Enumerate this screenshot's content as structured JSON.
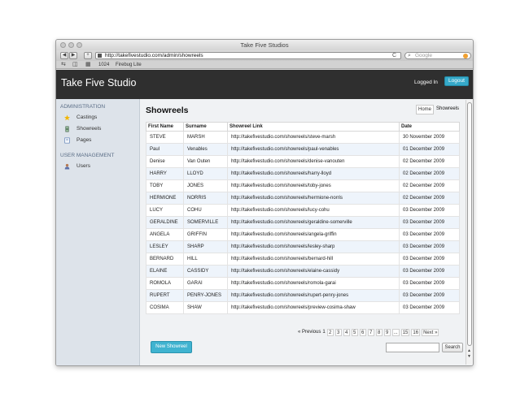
{
  "window": {
    "title": "Take Five Studios"
  },
  "browser": {
    "url": "http://takefivestudio.com/admin/showreels",
    "search_placeholder": "Google",
    "back_label": "◀",
    "forward_label": "▶",
    "add_label": "+",
    "reload_label": "C",
    "bookmarks": {
      "resolution": "1024",
      "firebug": "Firebug Lite"
    }
  },
  "app": {
    "brand": "Take Five Studio",
    "logged_in_label": "Logged In",
    "logout_label": "Logout"
  },
  "sidebar": {
    "sections": [
      {
        "heading": "ADMINISTRATION",
        "items": [
          {
            "label": "Castings",
            "icon": "star-icon"
          },
          {
            "label": "Showreels",
            "icon": "film-icon"
          },
          {
            "label": "Pages",
            "icon": "page-icon"
          }
        ]
      },
      {
        "heading": "USER MANAGEMENT",
        "items": [
          {
            "label": "Users",
            "icon": "user-icon"
          }
        ]
      }
    ]
  },
  "main": {
    "title": "Showreels",
    "breadcrumb": {
      "home": "Home",
      "current": "Showreels"
    },
    "table": {
      "headers": [
        "First Name",
        "Surname",
        "Showreel Link",
        "Date"
      ],
      "rows": [
        [
          "STEVE",
          "MARSH",
          "http://takefivestudio.com/showreels/steve-marsh",
          "30 November 2009"
        ],
        [
          "Paul",
          "Venables",
          "http://takefivestudio.com/showreels/paul-venables",
          "01 December 2009"
        ],
        [
          "Denise",
          "Van Outen",
          "http://takefivestudio.com/showreels/denise-vanouten",
          "02 December 2009"
        ],
        [
          "HARRY",
          "LLOYD",
          "http://takefivestudio.com/showreels/harry-lloyd",
          "02 December 2009"
        ],
        [
          "TOBY",
          "JONES",
          "http://takefivestudio.com/showreels/toby-jones",
          "02 December 2009"
        ],
        [
          "HERMIONE",
          "NORRIS",
          "http://takefivestudio.com/showreels/hermione-norris",
          "02 December 2009"
        ],
        [
          "LUCY",
          "COHU",
          "http://takefivestudio.com/showreels/lucy-cohu",
          "03 December 2009"
        ],
        [
          "GERALDINE",
          "SOMERVILLE",
          "http://takefivestudio.com/showreels/geraldine-somerville",
          "03 December 2009"
        ],
        [
          "ANGELA",
          "GRIFFIN",
          "http://takefivestudio.com/showreels/angela-griffin",
          "03 December 2009"
        ],
        [
          "LESLEY",
          "SHARP",
          "http://takefivestudio.com/showreels/lesley-sharp",
          "03 December 2009"
        ],
        [
          "BERNARD",
          "HILL",
          "http://takefivestudio.com/showreels/bernard-hill",
          "03 December 2009"
        ],
        [
          "ELAINE",
          "CASSIDY",
          "http://takefivestudio.com/showreels/elaine-cassidy",
          "03 December 2009"
        ],
        [
          "ROMOLA",
          "GARAI",
          "http://takefivestudio.com/showreels/romola-garai",
          "03 December 2009"
        ],
        [
          "RUPERT",
          "PENRY-JONES",
          "http://takefivestudio.com/showreels/rupert-penry-jones",
          "03 December 2009"
        ],
        [
          "COSIMA",
          "SHAW",
          "http://takefivestudio.com/showreels/preview-cosima-shaw",
          "03 December 2009"
        ]
      ]
    },
    "pagination": {
      "previous": "« Previous",
      "current": "1",
      "pages": [
        "2",
        "3",
        "4",
        "5",
        "6",
        "7",
        "8",
        "9"
      ],
      "ellipsis": "...",
      "last_pages": [
        "15",
        "16"
      ],
      "next": "Next »"
    },
    "new_button": "New Showreel",
    "search_button": "Search",
    "search_value": ""
  },
  "colors": {
    "accent": "#3fb3d0",
    "header_bg": "#2f2f2f",
    "sidebar_bg": "#dde3ea"
  }
}
